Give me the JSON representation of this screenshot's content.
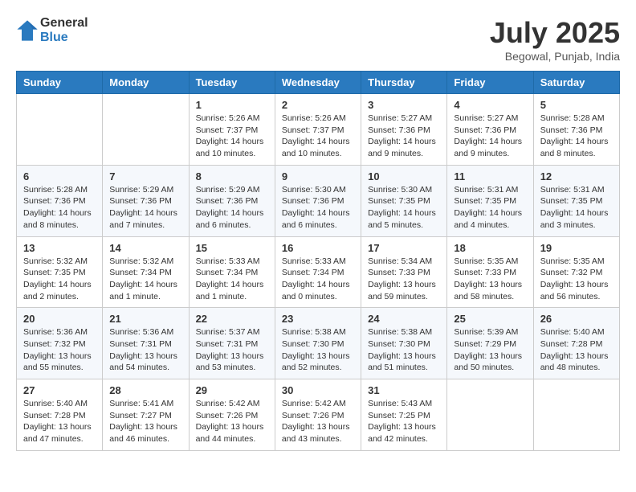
{
  "logo": {
    "general": "General",
    "blue": "Blue"
  },
  "title": "July 2025",
  "subtitle": "Begowal, Punjab, India",
  "weekdays": [
    "Sunday",
    "Monday",
    "Tuesday",
    "Wednesday",
    "Thursday",
    "Friday",
    "Saturday"
  ],
  "weeks": [
    [
      {
        "day": null,
        "info": null
      },
      {
        "day": null,
        "info": null
      },
      {
        "day": "1",
        "info": "Sunrise: 5:26 AM\nSunset: 7:37 PM\nDaylight: 14 hours and 10 minutes."
      },
      {
        "day": "2",
        "info": "Sunrise: 5:26 AM\nSunset: 7:37 PM\nDaylight: 14 hours and 10 minutes."
      },
      {
        "day": "3",
        "info": "Sunrise: 5:27 AM\nSunset: 7:36 PM\nDaylight: 14 hours and 9 minutes."
      },
      {
        "day": "4",
        "info": "Sunrise: 5:27 AM\nSunset: 7:36 PM\nDaylight: 14 hours and 9 minutes."
      },
      {
        "day": "5",
        "info": "Sunrise: 5:28 AM\nSunset: 7:36 PM\nDaylight: 14 hours and 8 minutes."
      }
    ],
    [
      {
        "day": "6",
        "info": "Sunrise: 5:28 AM\nSunset: 7:36 PM\nDaylight: 14 hours and 8 minutes."
      },
      {
        "day": "7",
        "info": "Sunrise: 5:29 AM\nSunset: 7:36 PM\nDaylight: 14 hours and 7 minutes."
      },
      {
        "day": "8",
        "info": "Sunrise: 5:29 AM\nSunset: 7:36 PM\nDaylight: 14 hours and 6 minutes."
      },
      {
        "day": "9",
        "info": "Sunrise: 5:30 AM\nSunset: 7:36 PM\nDaylight: 14 hours and 6 minutes."
      },
      {
        "day": "10",
        "info": "Sunrise: 5:30 AM\nSunset: 7:35 PM\nDaylight: 14 hours and 5 minutes."
      },
      {
        "day": "11",
        "info": "Sunrise: 5:31 AM\nSunset: 7:35 PM\nDaylight: 14 hours and 4 minutes."
      },
      {
        "day": "12",
        "info": "Sunrise: 5:31 AM\nSunset: 7:35 PM\nDaylight: 14 hours and 3 minutes."
      }
    ],
    [
      {
        "day": "13",
        "info": "Sunrise: 5:32 AM\nSunset: 7:35 PM\nDaylight: 14 hours and 2 minutes."
      },
      {
        "day": "14",
        "info": "Sunrise: 5:32 AM\nSunset: 7:34 PM\nDaylight: 14 hours and 1 minute."
      },
      {
        "day": "15",
        "info": "Sunrise: 5:33 AM\nSunset: 7:34 PM\nDaylight: 14 hours and 1 minute."
      },
      {
        "day": "16",
        "info": "Sunrise: 5:33 AM\nSunset: 7:34 PM\nDaylight: 14 hours and 0 minutes."
      },
      {
        "day": "17",
        "info": "Sunrise: 5:34 AM\nSunset: 7:33 PM\nDaylight: 13 hours and 59 minutes."
      },
      {
        "day": "18",
        "info": "Sunrise: 5:35 AM\nSunset: 7:33 PM\nDaylight: 13 hours and 58 minutes."
      },
      {
        "day": "19",
        "info": "Sunrise: 5:35 AM\nSunset: 7:32 PM\nDaylight: 13 hours and 56 minutes."
      }
    ],
    [
      {
        "day": "20",
        "info": "Sunrise: 5:36 AM\nSunset: 7:32 PM\nDaylight: 13 hours and 55 minutes."
      },
      {
        "day": "21",
        "info": "Sunrise: 5:36 AM\nSunset: 7:31 PM\nDaylight: 13 hours and 54 minutes."
      },
      {
        "day": "22",
        "info": "Sunrise: 5:37 AM\nSunset: 7:31 PM\nDaylight: 13 hours and 53 minutes."
      },
      {
        "day": "23",
        "info": "Sunrise: 5:38 AM\nSunset: 7:30 PM\nDaylight: 13 hours and 52 minutes."
      },
      {
        "day": "24",
        "info": "Sunrise: 5:38 AM\nSunset: 7:30 PM\nDaylight: 13 hours and 51 minutes."
      },
      {
        "day": "25",
        "info": "Sunrise: 5:39 AM\nSunset: 7:29 PM\nDaylight: 13 hours and 50 minutes."
      },
      {
        "day": "26",
        "info": "Sunrise: 5:40 AM\nSunset: 7:28 PM\nDaylight: 13 hours and 48 minutes."
      }
    ],
    [
      {
        "day": "27",
        "info": "Sunrise: 5:40 AM\nSunset: 7:28 PM\nDaylight: 13 hours and 47 minutes."
      },
      {
        "day": "28",
        "info": "Sunrise: 5:41 AM\nSunset: 7:27 PM\nDaylight: 13 hours and 46 minutes."
      },
      {
        "day": "29",
        "info": "Sunrise: 5:42 AM\nSunset: 7:26 PM\nDaylight: 13 hours and 44 minutes."
      },
      {
        "day": "30",
        "info": "Sunrise: 5:42 AM\nSunset: 7:26 PM\nDaylight: 13 hours and 43 minutes."
      },
      {
        "day": "31",
        "info": "Sunrise: 5:43 AM\nSunset: 7:25 PM\nDaylight: 13 hours and 42 minutes."
      },
      {
        "day": null,
        "info": null
      },
      {
        "day": null,
        "info": null
      }
    ]
  ]
}
